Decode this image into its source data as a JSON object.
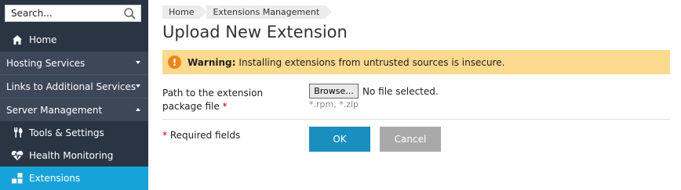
{
  "sidebar": {
    "search": {
      "placeholder": "Search..."
    },
    "home": "Home",
    "sections": [
      {
        "label": "Hosting Services",
        "state": "collapsed"
      },
      {
        "label": "Links to Additional Services",
        "state": "collapsed"
      },
      {
        "label": "Server Management",
        "state": "expanded"
      }
    ],
    "server_items": [
      {
        "label": "Tools & Settings",
        "icon": "tools-icon"
      },
      {
        "label": "Health Monitoring",
        "icon": "heart-pulse-icon"
      },
      {
        "label": "Extensions",
        "icon": "extensions-icon",
        "active": true
      }
    ]
  },
  "breadcrumb": [
    "Home",
    "Extensions Management"
  ],
  "page_title": "Upload New Extension",
  "warning": {
    "icon": "!",
    "label": "Warning:",
    "text": "Installing extensions from untrusted sources is insecure."
  },
  "form": {
    "field_label": "Path to the extension package file",
    "required_mark": "*",
    "browse_label": "Browse...",
    "file_status": "No file selected.",
    "hint": "*.rpm, *.zip",
    "required_note_star": "*",
    "required_note": "Required fields",
    "ok_label": "OK",
    "cancel_label": "Cancel"
  },
  "colors": {
    "sidebar_bg": "#2a3544",
    "section_bg": "#3c4757",
    "active_bg": "#17a3d9",
    "warning_bg": "#fbd98e",
    "ok_bg": "#1a8fbf",
    "cancel_bg": "#a9a9a9"
  }
}
